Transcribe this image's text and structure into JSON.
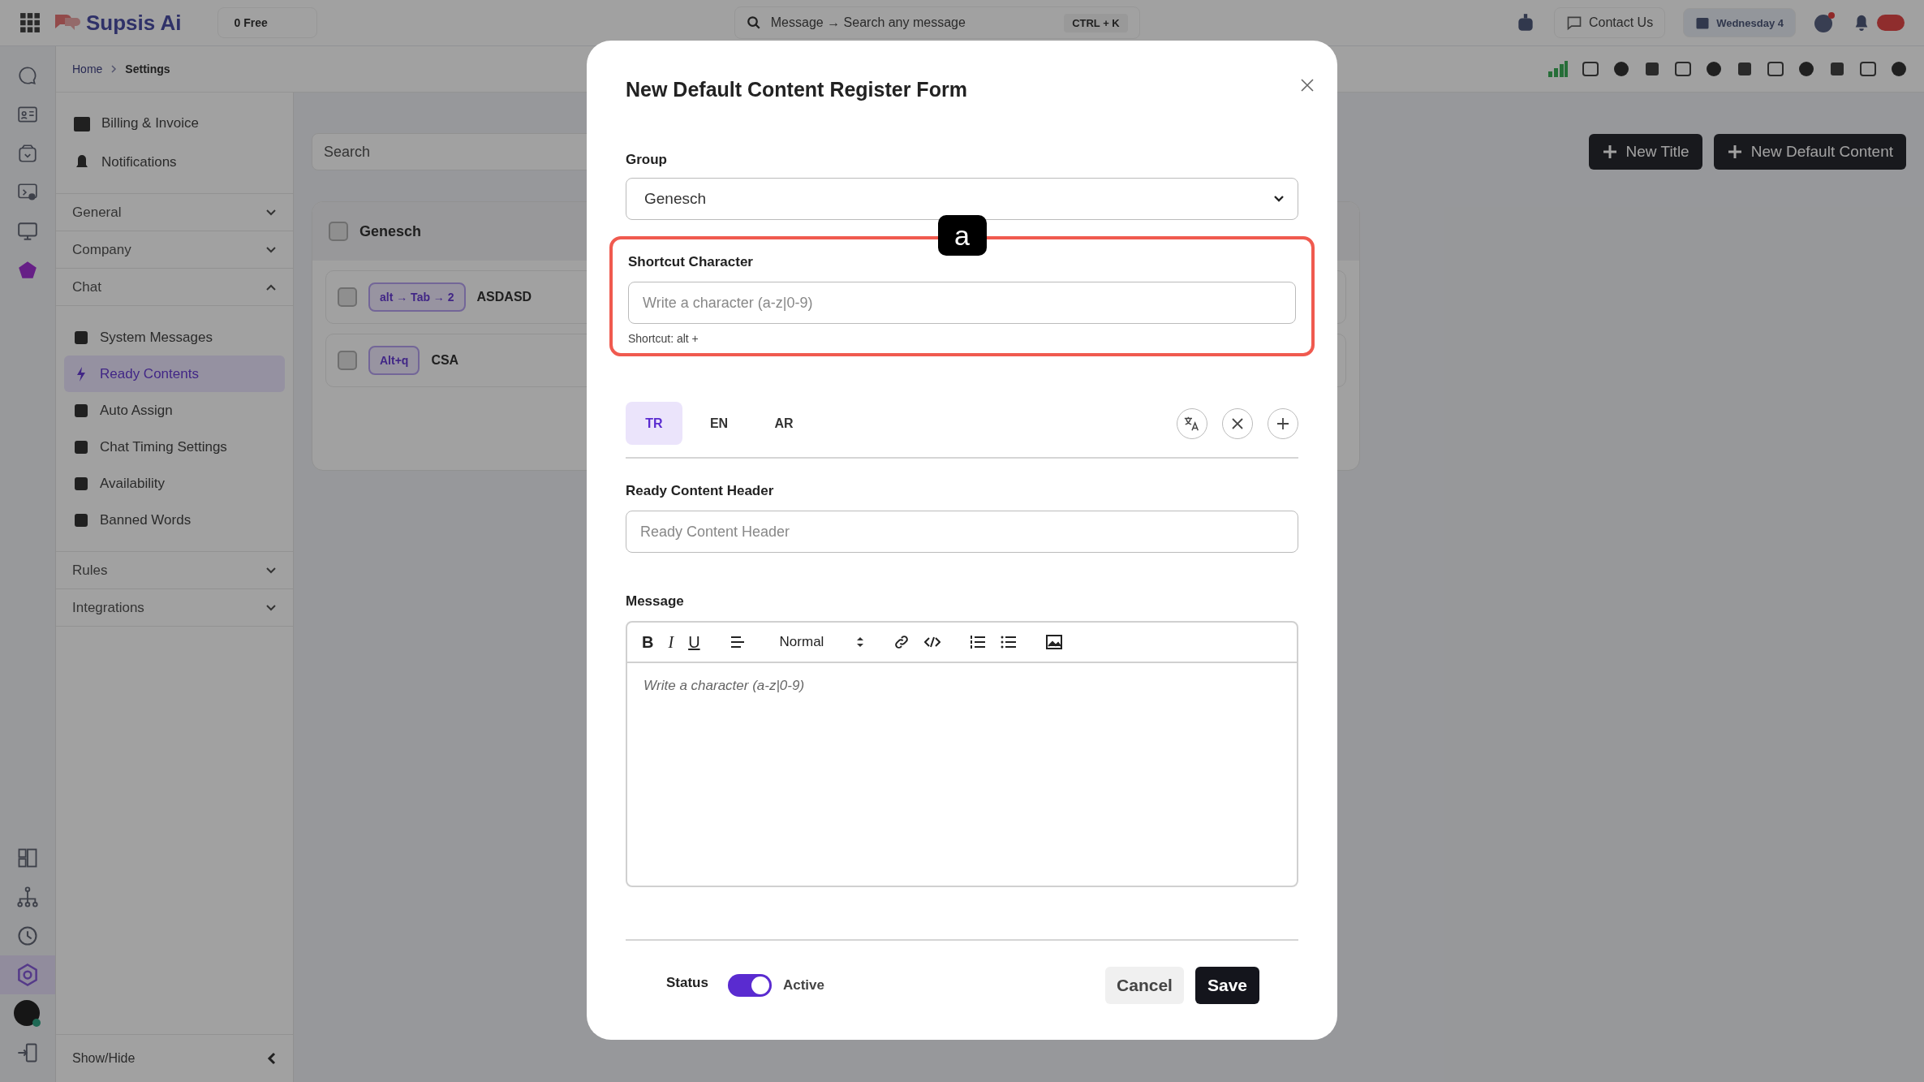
{
  "top_bar": {
    "logo": "Supsis Ai",
    "plan": "0 Free",
    "search_placeholder": "Message → Search any message",
    "search_shortcut": "CTRL + K",
    "contact": "Contact Us",
    "date": "Wednesday 4"
  },
  "rail": [
    {
      "kind": "chat",
      "selected": false
    },
    {
      "kind": "card",
      "selected": false
    },
    {
      "kind": "box",
      "selected": false
    },
    {
      "kind": "screen-user",
      "selected": false
    },
    {
      "kind": "monitor",
      "selected": false
    },
    {
      "kind": "shape",
      "selected": false
    }
  ],
  "rail_bottom": [
    {
      "kind": "layout",
      "selected": false
    },
    {
      "kind": "tree",
      "selected": false
    },
    {
      "kind": "clock",
      "selected": false
    },
    {
      "kind": "gear",
      "selected": true
    },
    {
      "kind": "avatar",
      "selected": false
    },
    {
      "kind": "logout",
      "selected": false
    }
  ],
  "breadcrumb": {
    "home": "Home",
    "current": "Settings"
  },
  "sidebar": {
    "top_items": [
      "Billing & Invoice",
      "Notifications"
    ],
    "sections": [
      {
        "label": "General",
        "expanded": false
      },
      {
        "label": "Company",
        "expanded": false
      },
      {
        "label": "Chat",
        "expanded": true,
        "children": [
          {
            "label": "System Messages",
            "selected": false
          },
          {
            "label": "Ready Contents",
            "selected": true
          },
          {
            "label": "Auto Assign",
            "selected": false
          },
          {
            "label": "Chat Timing Settings",
            "selected": false
          },
          {
            "label": "Availability",
            "selected": false
          },
          {
            "label": "Banned Words",
            "selected": false
          }
        ]
      },
      {
        "label": "Rules",
        "expanded": false
      },
      {
        "label": "Integrations",
        "expanded": false
      }
    ],
    "footer": "Show/Hide"
  },
  "content": {
    "search_placeholder": "Search",
    "buttons": [
      "New Title",
      "New Default Content"
    ],
    "group": {
      "name": "Genesch",
      "rows": [
        {
          "shortcut": "alt → Tab → 2",
          "title": "ASDASD"
        },
        {
          "shortcut": "Alt+q",
          "title": "CSA"
        }
      ]
    }
  },
  "modal": {
    "title": "New Default Content Register Form",
    "group": {
      "label": "Group",
      "value": "Genesch"
    },
    "shortcut": {
      "label": "Shortcut Character",
      "placeholder": "Write a character (a-z|0-9)",
      "hint": "Shortcut: alt +",
      "highlighted": true,
      "annotation": "a"
    },
    "languages": [
      {
        "label": "TR",
        "selected": true
      },
      {
        "label": "EN",
        "selected": false
      },
      {
        "label": "AR",
        "selected": false
      }
    ],
    "header": {
      "label": "Ready Content Header",
      "placeholder": "Ready Content Header"
    },
    "message": {
      "label": "Message",
      "placeholder": "Write a character (a-z|0-9)",
      "toolbar": [
        {
          "kind": "bold",
          "text": "B"
        },
        {
          "kind": "italic",
          "text": "I"
        },
        {
          "kind": "underline",
          "text": "U"
        },
        {
          "kind": "align"
        },
        {
          "kind": "size",
          "text": "Normal"
        },
        {
          "kind": "link"
        },
        {
          "kind": "code"
        },
        {
          "kind": "ordered"
        },
        {
          "kind": "bullet"
        },
        {
          "kind": "image"
        }
      ]
    },
    "status": {
      "label": "Status",
      "on": true,
      "text": "Active"
    },
    "buttons": {
      "cancel": "Cancel",
      "save": "Save"
    }
  }
}
